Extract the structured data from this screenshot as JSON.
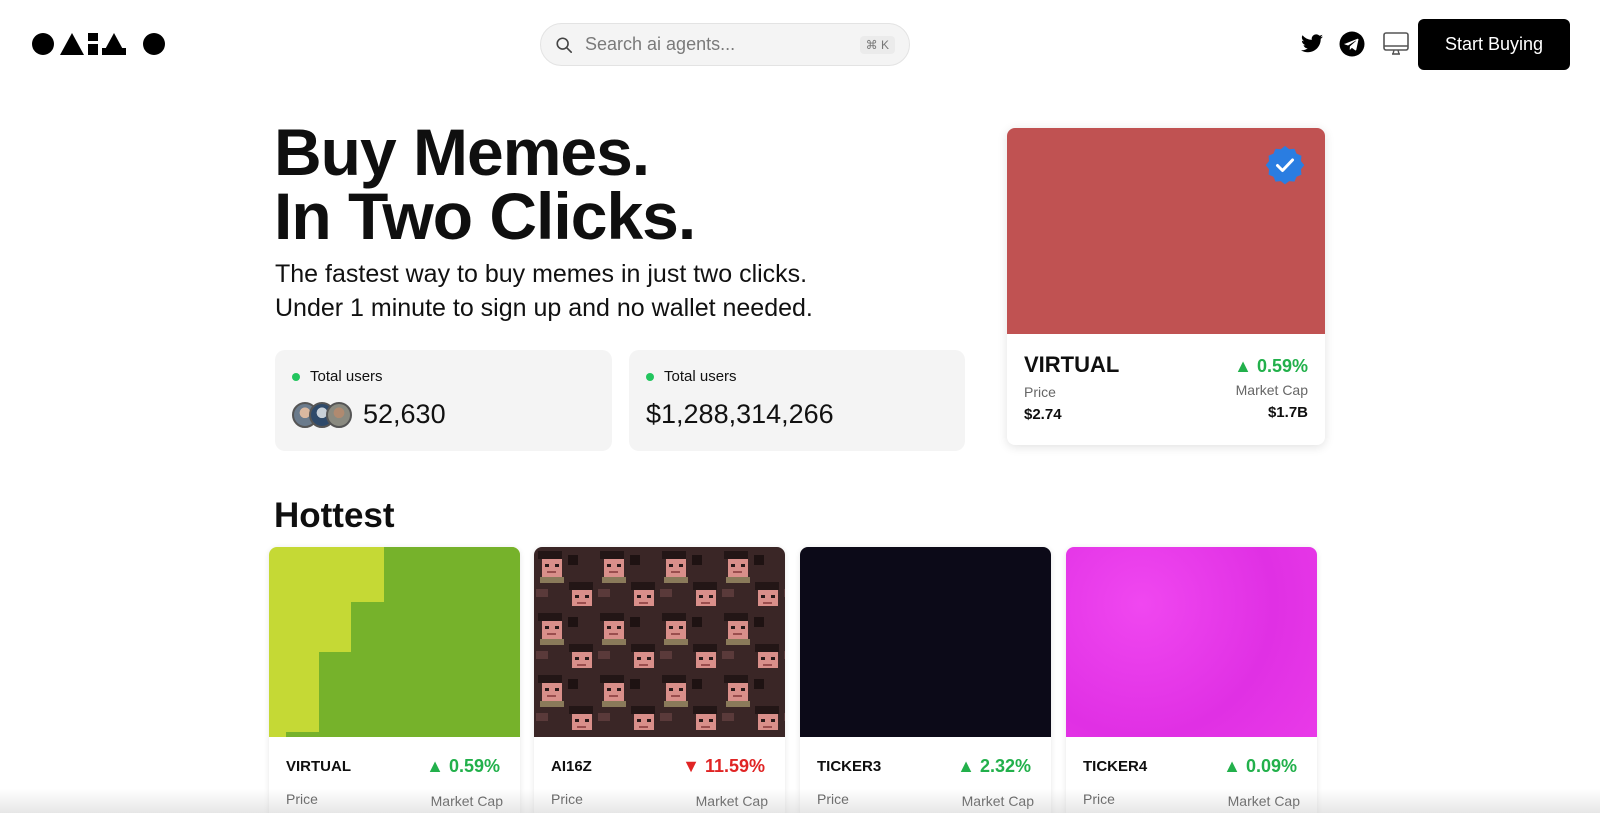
{
  "header": {
    "logo_icon": "shapes-logo",
    "search_placeholder": "Search ai agents...",
    "search_shortcut": "⌘ K",
    "social_icons": [
      "twitter-icon",
      "telegram-icon",
      "monitor-icon"
    ],
    "cta_label": "Start Buying"
  },
  "hero": {
    "title_line1": "Buy Memes.",
    "title_line2": "In Two Clicks.",
    "subtitle_line1": "The fastest way to buy memes in just two clicks.",
    "subtitle_line2": "Under 1 minute to sign up and no wallet needed."
  },
  "stats": [
    {
      "label": "Total users",
      "value": "52,630"
    },
    {
      "label": "Total users",
      "value": "$1,288,314,266"
    }
  ],
  "featured": {
    "name": "VIRTUAL",
    "change": "▲ 0.59%",
    "price_label": "Price",
    "price": "$2.74",
    "mcap_label": "Market Cap",
    "mcap": "$1.7B",
    "image_color": "#c05252",
    "verified_icon": "verified-badge-icon"
  },
  "hottest": {
    "title": "Hottest",
    "cards": [
      {
        "name": "VIRTUAL",
        "change": "▲ 0.59%",
        "direction": "up",
        "price_label": "Price",
        "mcap_label": "Market Cap"
      },
      {
        "name": "AI16Z",
        "change": "▼ 11.59%",
        "direction": "down",
        "price_label": "Price",
        "mcap_label": "Market Cap"
      },
      {
        "name": "TICKER3",
        "change": "▲ 2.32%",
        "direction": "up",
        "price_label": "Price",
        "mcap_label": "Market Cap"
      },
      {
        "name": "TICKER4",
        "change": "▲ 0.09%",
        "direction": "up",
        "price_label": "Price",
        "mcap_label": "Market Cap"
      }
    ]
  },
  "colors": {
    "up": "#22b04b",
    "down": "#e02424",
    "status_dot": "#22c55e",
    "cta_bg": "#000000"
  }
}
